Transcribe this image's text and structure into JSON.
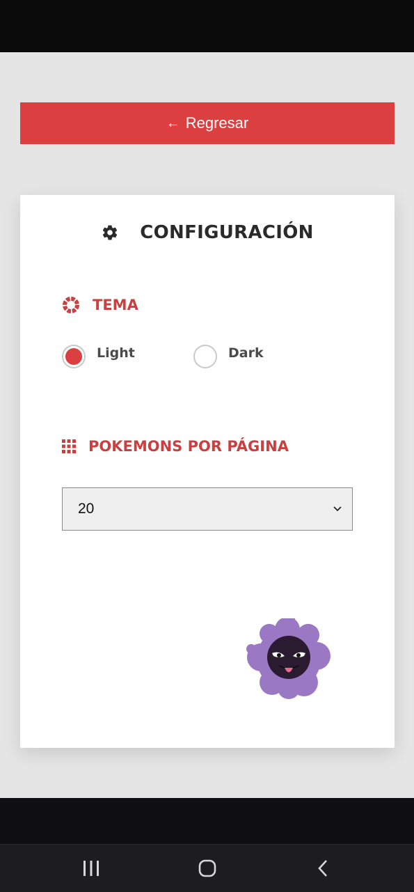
{
  "header": {
    "back_label": "Regresar",
    "back_arrow": "←"
  },
  "config": {
    "title": "CONFIGURACIÓN",
    "title_icon": "gear-icon",
    "theme": {
      "label": "TEMA",
      "icon": "lifebuoy-icon",
      "options": [
        "Light",
        "Dark"
      ],
      "selected": "Light"
    },
    "per_page": {
      "label": "POKEMONS POR PÁGINA",
      "icon": "grid-icon",
      "value": "20"
    },
    "mascot": "gastly-ghost-image"
  },
  "colors": {
    "accent": "#dc3f40",
    "section_text": "#c94040",
    "background": "#e5e5e5",
    "card": "#ffffff",
    "ghost": "#9a78c4"
  },
  "navbar": {
    "icons": [
      "recent-apps-icon",
      "home-icon",
      "back-icon"
    ]
  }
}
